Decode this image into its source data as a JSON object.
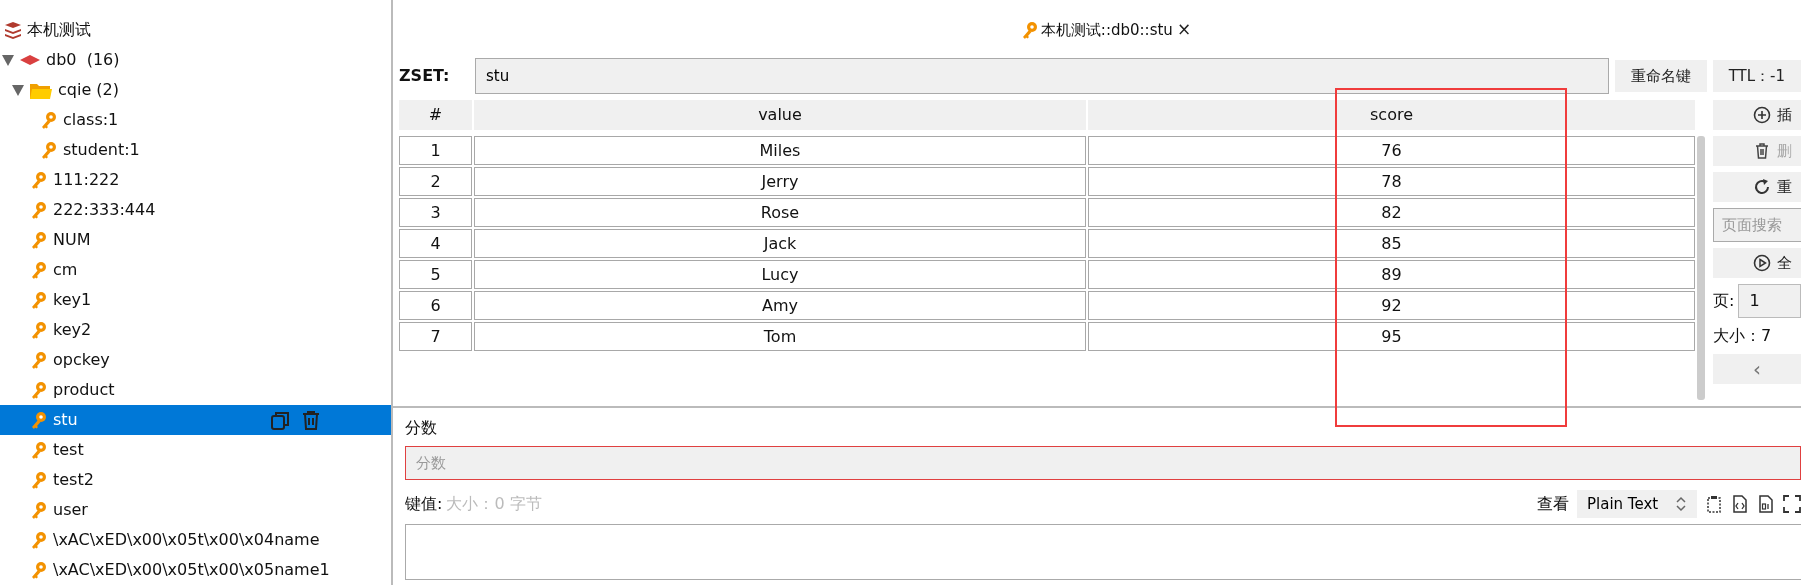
{
  "connection": {
    "name": "本机测试"
  },
  "tree": [
    {
      "kind": "db",
      "label": "db0  (16)",
      "expanded": true,
      "children": [
        {
          "kind": "folder",
          "label": "cqie (2)",
          "expanded": true,
          "children": [
            {
              "kind": "key",
              "label": "class:1",
              "selected": false
            },
            {
              "kind": "key",
              "label": "student:1",
              "selected": false
            }
          ]
        },
        {
          "kind": "key",
          "label": "111:222",
          "selected": false
        },
        {
          "kind": "key",
          "label": "222:333:444",
          "selected": false
        },
        {
          "kind": "key",
          "label": "NUM",
          "selected": false
        },
        {
          "kind": "key",
          "label": "cm",
          "selected": false
        },
        {
          "kind": "key",
          "label": "key1",
          "selected": false
        },
        {
          "kind": "key",
          "label": "key2",
          "selected": false
        },
        {
          "kind": "key",
          "label": "opckey",
          "selected": false
        },
        {
          "kind": "key",
          "label": "product",
          "selected": false
        },
        {
          "kind": "key",
          "label": "stu",
          "selected": true
        },
        {
          "kind": "key",
          "label": "test",
          "selected": false
        },
        {
          "kind": "key",
          "label": "test2",
          "selected": false
        },
        {
          "kind": "key",
          "label": "user",
          "selected": false
        },
        {
          "kind": "key",
          "label": "\\xAC\\xED\\x00\\x05t\\x00\\x04name",
          "selected": false
        },
        {
          "kind": "key",
          "label": "\\xAC\\xED\\x00\\x05t\\x00\\x05name1",
          "selected": false
        }
      ]
    }
  ],
  "tab": {
    "title": "本机测试::db0::stu",
    "close": "×"
  },
  "key_header": {
    "type_label": "ZSET:",
    "key_name": "stu",
    "rename_button": "重命名键",
    "ttl_button": "TTL：-1"
  },
  "table": {
    "columns": [
      "#",
      "value",
      "score"
    ],
    "rows": [
      [
        "1",
        "Miles",
        "76"
      ],
      [
        "2",
        "Jerry",
        "78"
      ],
      [
        "3",
        "Rose",
        "82"
      ],
      [
        "4",
        "Jack",
        "85"
      ],
      [
        "5",
        "Lucy",
        "89"
      ],
      [
        "6",
        "Amy",
        "92"
      ],
      [
        "7",
        "Tom",
        "95"
      ]
    ]
  },
  "side_panel": {
    "add_button": {
      "label": "插",
      "disabled": false
    },
    "delete_button": {
      "label": "删",
      "disabled": true
    },
    "reload_button": {
      "label": "重",
      "disabled": false
    },
    "search_placeholder": "页面搜索",
    "load_all_button": {
      "label": "全",
      "disabled": false
    },
    "page_label": "页:",
    "page_value": "1",
    "size_text": "大小：7",
    "prev_button": "‹"
  },
  "editor": {
    "field_label": "分数",
    "field_placeholder": "分数",
    "value_label": "键值:",
    "size_hint": "大小：0 字节",
    "view_label": "查看",
    "view_mode": "Plain Text"
  }
}
